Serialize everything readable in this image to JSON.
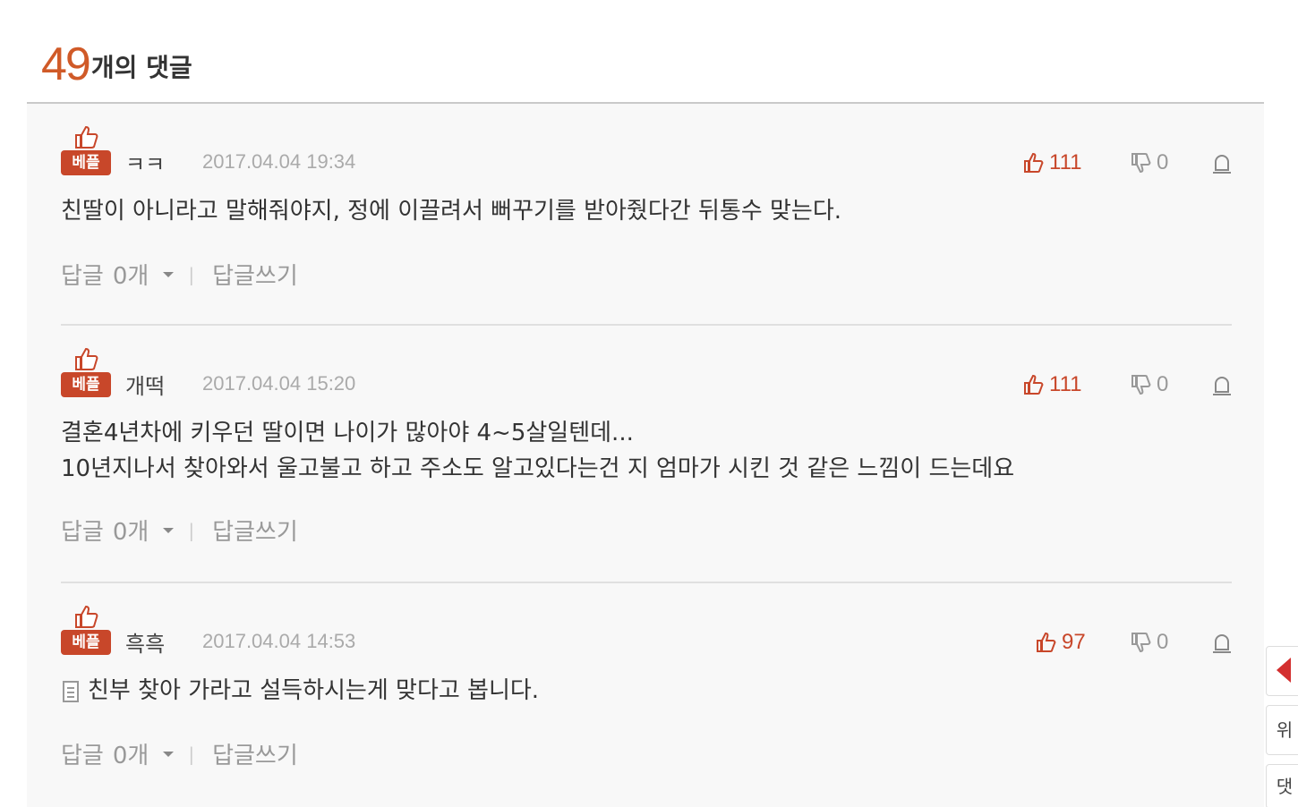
{
  "header": {
    "count": "49",
    "label": "개의 댓글"
  },
  "comments": [
    {
      "badge": "베플",
      "author": "ㅋㅋ",
      "date": "2017.04.04 19:34",
      "likes": "111",
      "dislikes": "0",
      "lines": [
        "친딸이 아니라고 말해줘야지, 정에 이끌려서 뻐꾸기를 받아줬다간 뒤통수 맞는다."
      ],
      "reply_label": "답글",
      "reply_count": "0개",
      "write_label": "답글쓰기"
    },
    {
      "badge": "베플",
      "author": "개떡",
      "date": "2017.04.04 15:20",
      "likes": "111",
      "dislikes": "0",
      "lines": [
        "결혼4년차에 키우던 딸이면 나이가 많아야 4~5살일텐데...",
        "10년지나서 찾아와서 울고불고 하고 주소도 알고있다는건 지 엄마가 시킨 것 같은 느낌이 드는데요"
      ],
      "reply_label": "답글",
      "reply_count": "0개",
      "write_label": "답글쓰기"
    },
    {
      "badge": "베플",
      "author": "흑흑",
      "date": "2017.04.04 14:53",
      "likes": "97",
      "dislikes": "0",
      "lines": [
        "친부 찾아 가라고 설득하시는게 맞다고 봅니다."
      ],
      "reply_label": "답글",
      "reply_count": "0개",
      "write_label": "답글쓰기"
    }
  ],
  "side": {
    "top_label": "위",
    "comment_label": "댓"
  },
  "colors": {
    "accent": "#d05a28",
    "badge": "#c8472a",
    "muted": "#999999"
  },
  "icons": [
    "thumbs-up-icon",
    "thumbs-down-icon",
    "report-icon",
    "attachment-icon",
    "caret-down-icon"
  ]
}
